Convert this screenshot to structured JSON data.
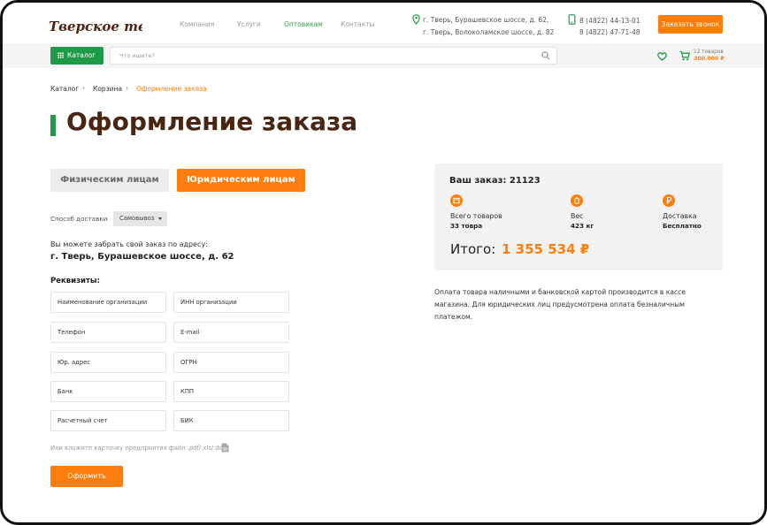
{
  "header": {
    "logo_text": "Тверское тепло",
    "nav": [
      "Компания",
      "Услуги",
      "Оптовикам",
      "Контакты"
    ],
    "active_nav": "Оптовикам",
    "addresses": [
      "г. Тверь, Бурашевское шоссе, д. 62,",
      "г. Тверь, Волоколамское шоссе, д. 82"
    ],
    "phones": [
      "8 (4822) 44-13-01",
      "8 (4822) 47-71-48"
    ],
    "call_button": "Заказать звонок"
  },
  "searchbar": {
    "catalog_button": "Каталог",
    "search_placeholder": "Что ищете?",
    "cart_count": "12 товаров",
    "cart_sum": "300.000 ₽"
  },
  "breadcrumb": [
    "Каталог",
    "Корзина",
    "Оформление заказа"
  ],
  "page_title": "Оформление заказа",
  "tabs": {
    "individuals": "Физическим лицам",
    "legal": "Юридическим лицам",
    "active": "legal"
  },
  "delivery": {
    "label": "Способ доставки",
    "selected": "Самовывоз"
  },
  "pickup": {
    "note": "Вы можете забрать свой заказ по адресу:",
    "address": "г. Тверь, Бурашевское шоссе, д. 62"
  },
  "requisites": {
    "title": "Реквизиты:",
    "fields": [
      "Наименование организации",
      "ИНН организации",
      "Телефон",
      "E-mail",
      "Юр. адрес",
      "ОГРН",
      "Банк",
      "КПП",
      "Расчетный счет",
      "БИК"
    ],
    "attach_note": "Или вложите карточку предприятия файл .pdf/.xls/.doc",
    "submit": "Оформить"
  },
  "summary": {
    "order": "Ваш заказ: 21123",
    "items_label": "Всего товаров",
    "items_value": "33 товра",
    "weight_label": "Вес",
    "weight_value": "423 кг",
    "delivery_label": "Доставка",
    "delivery_value": "Бесплатно",
    "total_label": "Итого:",
    "total_value": "1 355 534 ₽"
  },
  "payment_note": "Оплата товара наличными и банковской картой производится в кассе магазина. Для юридических лиц предусмотрена оплата безналичным платежом.",
  "colors": {
    "accent": "#ff7d0c",
    "green": "#1f9a47",
    "title_brown": "#4a2511"
  }
}
